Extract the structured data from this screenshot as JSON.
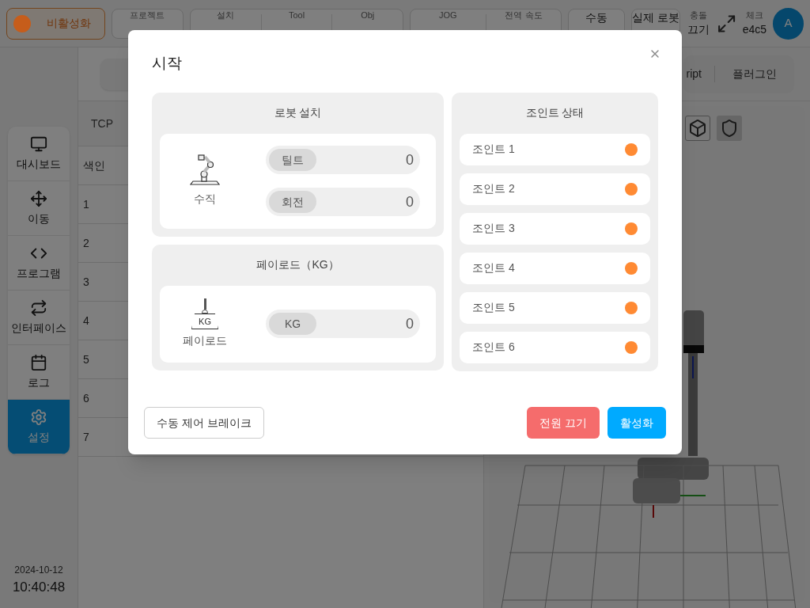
{
  "top_bar": {
    "status": {
      "label": "비활성화",
      "color": "#c65d1b"
    },
    "project": {
      "label": "프로젝트"
    },
    "setup_group": [
      {
        "label": "설치"
      },
      {
        "label": "Tool"
      },
      {
        "label": "Obj"
      }
    ],
    "jog_group": [
      {
        "label": "JOG"
      },
      {
        "label": "전역 속도"
      }
    ],
    "mode_button": "수동",
    "robot_button": "실제 로봇",
    "collision": {
      "label": "충돌",
      "value": "끄기"
    },
    "check": {
      "label": "체크",
      "value": "e4c5"
    },
    "avatar": "A"
  },
  "sidebar": {
    "items": [
      {
        "label": "대시보드",
        "selected": false
      },
      {
        "label": "이동",
        "selected": false
      },
      {
        "label": "프로그램",
        "selected": false
      },
      {
        "label": "인터페이스",
        "selected": false
      },
      {
        "label": "로그",
        "selected": false
      },
      {
        "label": "설정",
        "selected": true
      }
    ],
    "date": "2024-10-12",
    "time": "10:40:48"
  },
  "table": {
    "tab": "TCP",
    "header": "색인",
    "rows": [
      "1",
      "2",
      "3",
      "4",
      "5",
      "6",
      "7"
    ]
  },
  "right_panel": {
    "tabs": [
      "ript",
      "플러그인"
    ]
  },
  "modal": {
    "title": "시작",
    "install": {
      "title": "로봇 설치",
      "label": "수직",
      "fields": [
        {
          "label": "틸트",
          "value": "0"
        },
        {
          "label": "회전",
          "value": "0"
        }
      ]
    },
    "payload": {
      "title": "페이로드（KG）",
      "label": "페이로드",
      "icon_text": "KG",
      "fields": [
        {
          "label": "KG",
          "value": "0"
        }
      ]
    },
    "joints": {
      "title": "조인트 상태",
      "items": [
        {
          "name": "조인트 1",
          "color": "#ff8a33"
        },
        {
          "name": "조인트 2",
          "color": "#ff8a33"
        },
        {
          "name": "조인트 3",
          "color": "#ff8a33"
        },
        {
          "name": "조인트 4",
          "color": "#ff8a33"
        },
        {
          "name": "조인트 5",
          "color": "#ff8a33"
        },
        {
          "name": "조인트 6",
          "color": "#ff8a33"
        }
      ]
    },
    "brake_button": "수동 제어 브레이크",
    "power_off_button": "전원 끄기",
    "activate_button": "활성화"
  }
}
